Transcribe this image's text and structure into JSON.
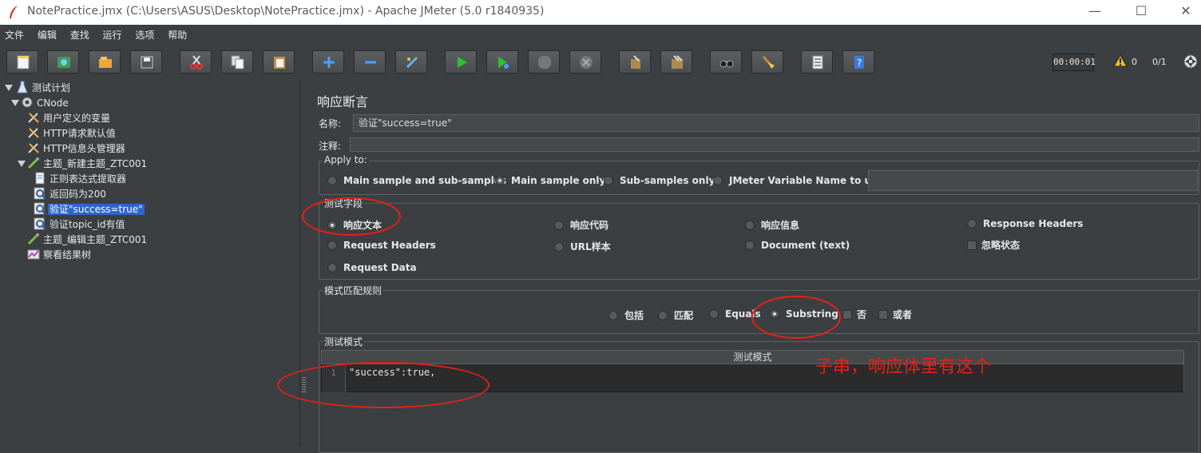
{
  "window": {
    "title": "NotePractice.jmx (C:\\Users\\ASUS\\Desktop\\NotePractice.jmx) - Apache JMeter (5.0 r1840935)",
    "minimize": "—",
    "maximize": "☐",
    "close": "✕"
  },
  "menu": [
    "文件",
    "编辑",
    "查找",
    "运行",
    "选项",
    "帮助"
  ],
  "toolbar": {
    "icons": [
      "new-icon",
      "templates-icon",
      "open-icon",
      "save-icon",
      "cut-icon",
      "copy-icon",
      "paste-icon",
      "expand-icon",
      "collapse-icon",
      "toggle-icon",
      "start-icon",
      "start-no-timers-icon",
      "stop-icon",
      "shutdown-icon",
      "clear-icon",
      "clear-all-icon",
      "search-icon",
      "reset-search-icon",
      "function-helper-icon",
      "help-icon"
    ],
    "timer": "00:00:01",
    "warnings": "0",
    "threads": "0/1"
  },
  "tree": [
    {
      "label": "测试计划",
      "icon": "test-plan-icon",
      "expanded": true
    },
    {
      "label": "CNode",
      "icon": "thread-group-icon",
      "expanded": true
    },
    {
      "label": "用户定义的变量",
      "icon": "config-icon"
    },
    {
      "label": "HTTP请求默认值",
      "icon": "config-icon"
    },
    {
      "label": "HTTP信息头管理器",
      "icon": "config-icon"
    },
    {
      "label": "主题_新建主题_ZTC001",
      "icon": "sampler-icon",
      "expanded": true
    },
    {
      "label": "正则表达式提取器",
      "icon": "extractor-icon"
    },
    {
      "label": "返回码为200",
      "icon": "assertion-icon"
    },
    {
      "label": "验证\"success=true\"",
      "icon": "assertion-icon",
      "selected": true
    },
    {
      "label": "验证topic_id有值",
      "icon": "assertion-icon"
    },
    {
      "label": "主题_编辑主题_ZTC001",
      "icon": "sampler-icon"
    },
    {
      "label": "察看结果树",
      "icon": "listener-icon"
    }
  ],
  "panel": {
    "heading": "响应断言",
    "name_label": "名称:",
    "name_value": "验证\"success=true\"",
    "comment_label": "注释:",
    "comment_value": "",
    "apply_to": {
      "legend": "Apply to:",
      "options": [
        "Main sample and sub-samples",
        "Main sample only",
        "Sub-samples only",
        "JMeter Variable Name to use"
      ],
      "selected": "Main sample only",
      "variable_value": ""
    },
    "test_field": {
      "legend": "测试字段",
      "options": [
        "响应文本",
        "响应代码",
        "响应信息",
        "Response Headers",
        "Request Headers",
        "URL样本",
        "Document (text)",
        "Request Data"
      ],
      "selected": "响应文本",
      "ignore_status_label": "忽略状态"
    },
    "pattern_rules": {
      "legend": "模式匹配规则",
      "options": [
        "包括",
        "匹配",
        "Equals",
        "Substring"
      ],
      "selected": "Substring",
      "not_label": "否",
      "or_label": "或者"
    },
    "patterns": {
      "legend": "测试模式",
      "column_header": "测试模式",
      "line_number": "1",
      "line_1": "\"success\":true,"
    }
  },
  "annotation": {
    "text": "子串，响应体里有这个",
    "color": "#e8201a"
  }
}
